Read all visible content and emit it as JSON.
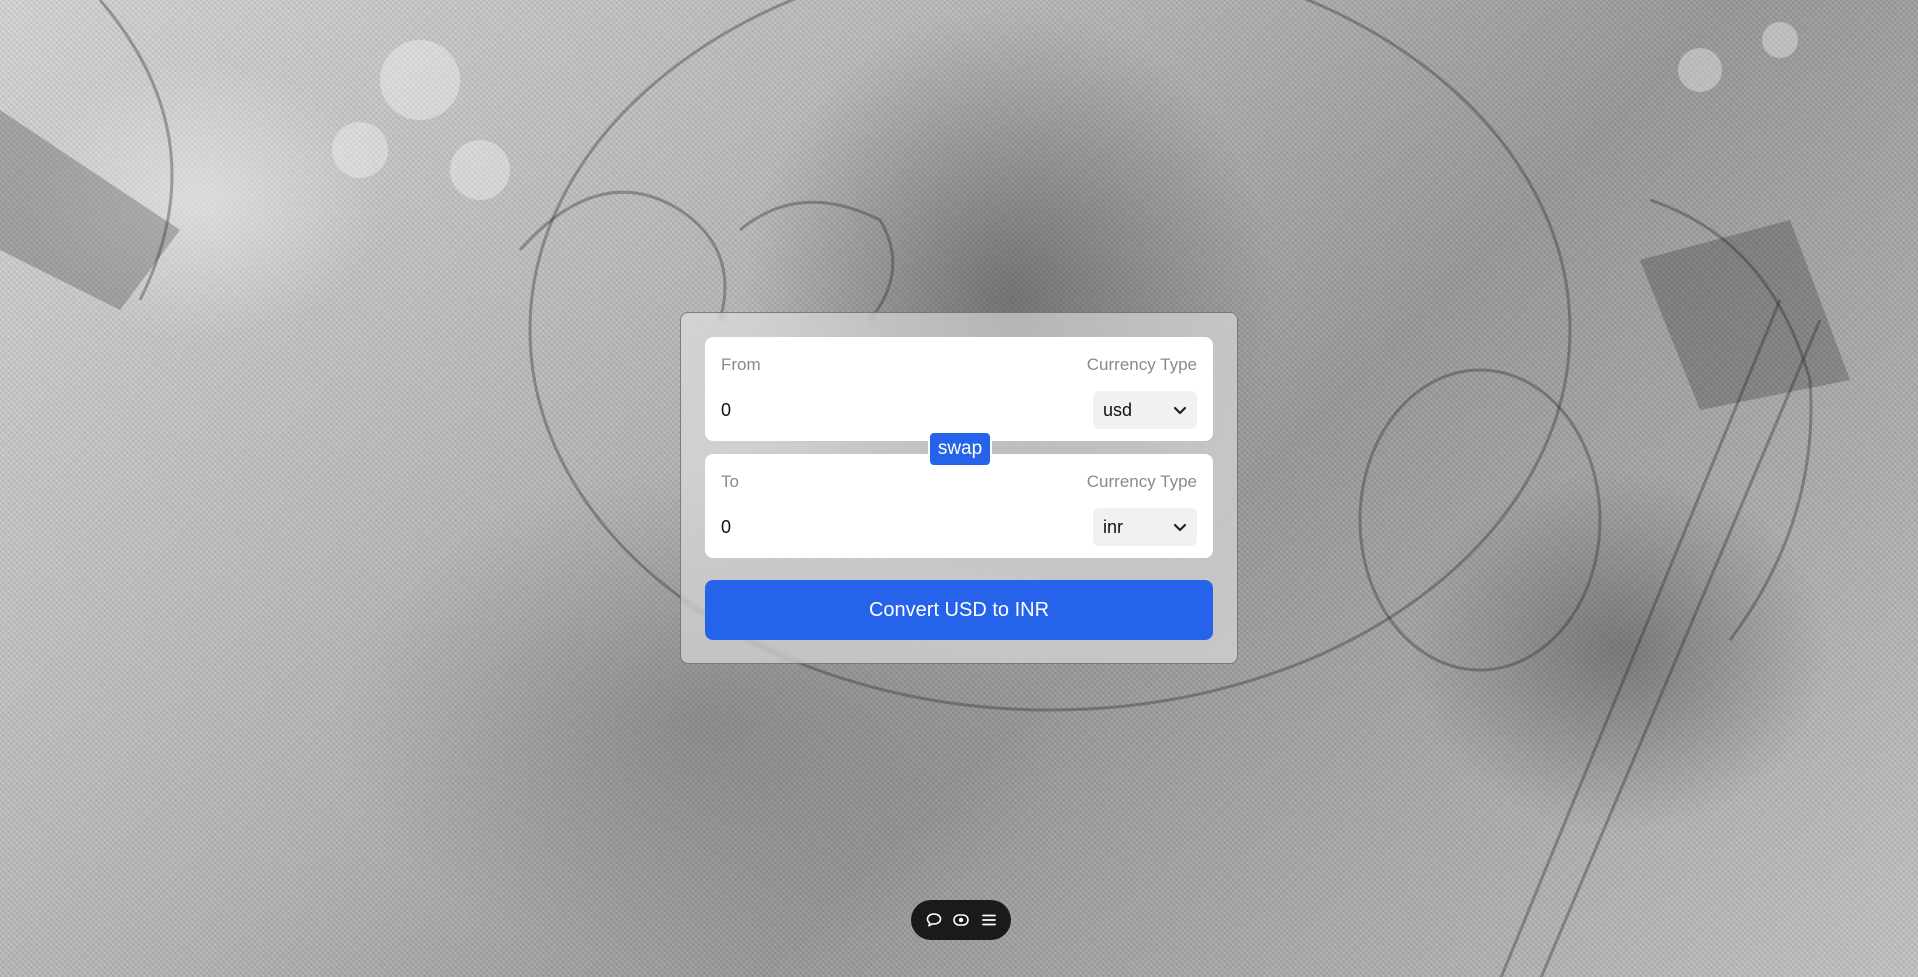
{
  "converter": {
    "from": {
      "label": "From",
      "currency_type_label": "Currency Type",
      "amount": "0",
      "currency": "usd"
    },
    "swap_label": "swap",
    "to": {
      "label": "To",
      "currency_type_label": "Currency Type",
      "amount": "0",
      "currency": "inr"
    },
    "convert_label": "Convert USD to INR"
  },
  "toolbar": {
    "icons": [
      "comment-icon",
      "eye-icon",
      "menu-icon"
    ]
  },
  "colors": {
    "accent": "#2563eb",
    "panel": "#ffffff",
    "toolbar": "#1a1a1a"
  }
}
